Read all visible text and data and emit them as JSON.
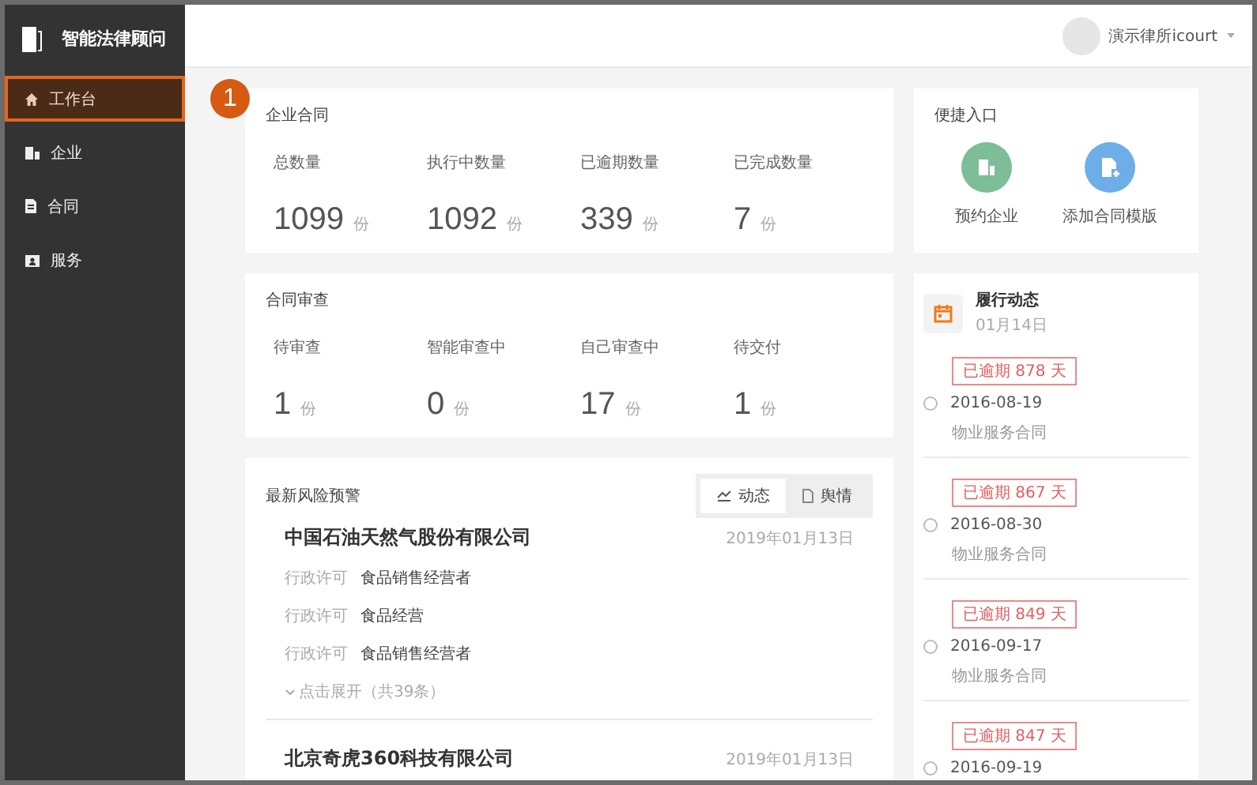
{
  "sidebar": {
    "logo": "智能法律顾问",
    "items": [
      {
        "label": "工作台",
        "selected": true
      },
      {
        "label": "企业",
        "selected": false
      },
      {
        "label": "合同",
        "selected": false
      },
      {
        "label": "服务",
        "selected": false
      }
    ]
  },
  "header": {
    "user": "演示律所icourt"
  },
  "annotation": {
    "label": "1"
  },
  "contract_stats": {
    "title": "企业合同",
    "stats": [
      {
        "label": "总数量",
        "value": "1099",
        "unit": "份"
      },
      {
        "label": "执行中数量",
        "value": "1092",
        "unit": "份"
      },
      {
        "label": "已逾期数量",
        "value": "339",
        "unit": "份"
      },
      {
        "label": "已完成数量",
        "value": "7",
        "unit": "份"
      }
    ]
  },
  "review_stats": {
    "title": "合同审查",
    "stats": [
      {
        "label": "待审查",
        "value": "1",
        "unit": "份"
      },
      {
        "label": "智能审查中",
        "value": "0",
        "unit": "份"
      },
      {
        "label": "自己审查中",
        "value": "17",
        "unit": "份"
      },
      {
        "label": "待交付",
        "value": "1",
        "unit": "份"
      }
    ]
  },
  "risk": {
    "title": "最新风险预警",
    "tabs": [
      {
        "label": "动态",
        "selected": true
      },
      {
        "label": "舆情",
        "selected": false
      }
    ],
    "companies": [
      {
        "name": "中国石油天然气股份有限公司",
        "date": "2019年01月13日",
        "entries": [
          {
            "type": "行政许可",
            "text": "食品销售经营者"
          },
          {
            "type": "行政许可",
            "text": "食品经营"
          },
          {
            "type": "行政许可",
            "text": "食品销售经营者"
          }
        ],
        "expand": "点击展开（共39条）"
      },
      {
        "name": "北京奇虎360科技有限公司",
        "date": "2019年01月13日"
      }
    ]
  },
  "shortcuts": {
    "title": "便捷入口",
    "items": [
      {
        "label": "预约企业",
        "kind": "company",
        "color": "#7dbd98"
      },
      {
        "label": "添加合同模版",
        "kind": "template",
        "color": "#6eaee8"
      }
    ]
  },
  "performance": {
    "title": "履行动态",
    "date": "01月14日",
    "items": [
      {
        "badge": "已逾期 878 天",
        "date": "2016-08-19",
        "name": "物业服务合同",
        "checked": false
      },
      {
        "badge": "已逾期 867 天",
        "date": "2016-08-30",
        "name": "物业服务合同",
        "checked": false
      },
      {
        "badge": "已逾期 849 天",
        "date": "2016-09-17",
        "name": "物业服务合同",
        "checked": false
      },
      {
        "badge": "已逾期 847 天",
        "date": "2016-09-19",
        "checked": false
      }
    ]
  }
}
